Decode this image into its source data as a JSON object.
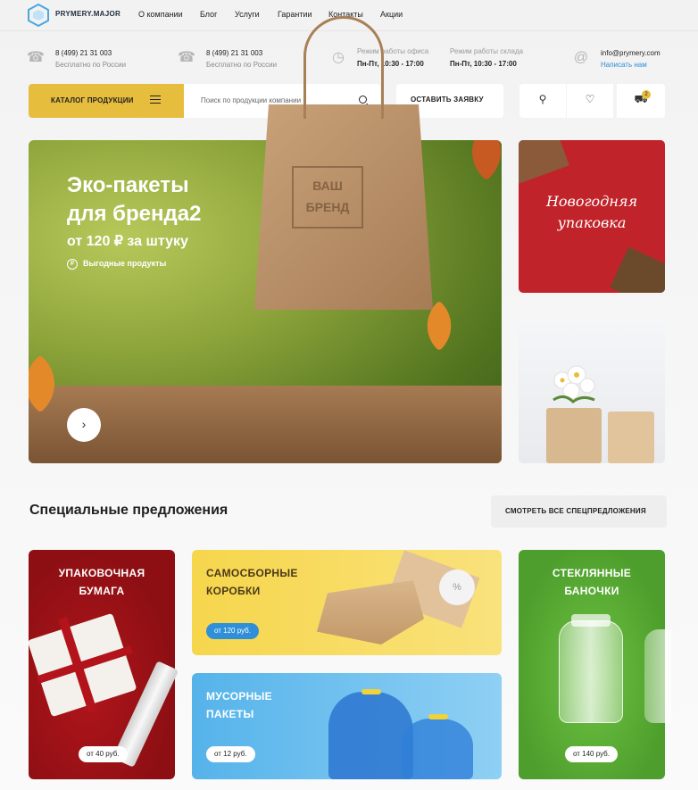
{
  "brand": {
    "name": "PRYMERY.MAJOR"
  },
  "nav": [
    "О компании",
    "Блог",
    "Услуги",
    "Гарантии",
    "Контакты",
    "Акции"
  ],
  "contacts": [
    {
      "phone": "8 (499) 21 31 003",
      "note": "Бесплатно по России"
    },
    {
      "phone": "8 (499) 21 31 003",
      "note": "Бесплатно по России"
    }
  ],
  "hours": [
    {
      "label": "Режим работы офиса",
      "value": "Пн-Пт, 10:30 - 17:00"
    },
    {
      "label": "Режим работы склада",
      "value": "Пн-Пт, 10:30 - 17:00"
    }
  ],
  "email": {
    "address": "info@prymery.com",
    "link": "Написать нам"
  },
  "toolbar": {
    "catalog_label": "КАТАЛОГ ПРОДУКЦИИ",
    "search_placeholder": "Поиск по продукции компании",
    "apply_label": "ОСТАВИТЬ ЗАЯВКУ",
    "cart_count": "2"
  },
  "hero": {
    "title_line1": "Эко-пакеты",
    "title_line2": "для бренда2",
    "price": "от 120 ₽ за штуку",
    "tag": "Выгодные продукты",
    "tag_icon": "₽",
    "stamp_line1": "ВАШ",
    "stamp_line2": "БРЕНД"
  },
  "side_banner": {
    "text": "Новогодняя упаковка"
  },
  "specials": {
    "title": "Специальные предложения",
    "all_label": "СМОТРЕТЬ ВСЕ СПЕЦПРЕДЛОЖЕНИЯ",
    "cards": [
      {
        "line1": "УПАКОВОЧНАЯ",
        "line2": "БУМАГА",
        "price": "от 40 руб."
      },
      {
        "line1": "САМОСБОРНЫЕ",
        "line2": "КОРОБКИ",
        "price": "от 120 руб."
      },
      {
        "line1": "МУСОРНЫЕ",
        "line2": "ПАКЕТЫ",
        "price": "от 12 руб."
      },
      {
        "line1": "СТЕКЛЯННЫЕ",
        "line2": "БАНОЧКИ",
        "price": "от 140 руб."
      }
    ]
  },
  "colors": {
    "accent": "#e7bd3d",
    "link": "#2f8fd8"
  }
}
